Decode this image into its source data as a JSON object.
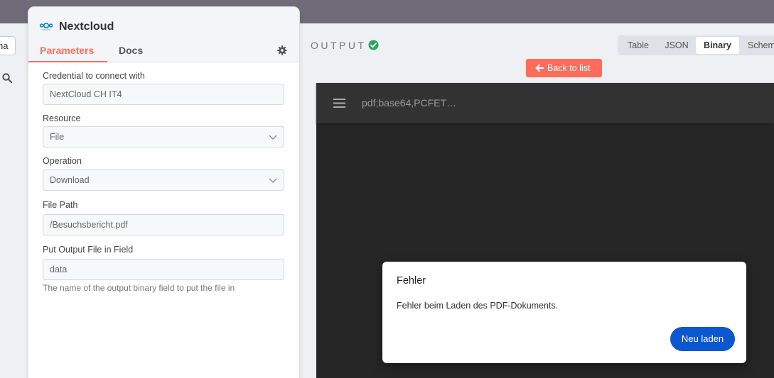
{
  "prev_panel": {
    "input_value": "na"
  },
  "node": {
    "title": "Nextcloud",
    "tabs": [
      {
        "label": "Parameters",
        "active": true
      },
      {
        "label": "Docs",
        "active": false
      }
    ],
    "fields": {
      "credential": {
        "label": "Credential to connect with",
        "value": "NextCloud CH IT4"
      },
      "resource": {
        "label": "Resource",
        "value": "File"
      },
      "operation": {
        "label": "Operation",
        "value": "Download"
      },
      "file_path": {
        "label": "File Path",
        "value": "/Besuchsbericht.pdf"
      },
      "output_field": {
        "label": "Put Output File in Field",
        "value": "data",
        "hint": "The name of the output binary field to put the file in"
      }
    }
  },
  "output": {
    "title": "OUTPUT",
    "status_icon": "success-check-icon",
    "view_modes": [
      "Table",
      "JSON",
      "Binary",
      "Schema"
    ],
    "active_view": "Binary",
    "back_button": "Back to list"
  },
  "viewer": {
    "title": "pdf;base64,PCFET…",
    "dialog": {
      "title": "Fehler",
      "message": "Fehler beim Laden des PDF-Dokuments.",
      "button": "Neu laden"
    }
  },
  "colors": {
    "accent": "#ff6d5a",
    "success": "#29a568",
    "viewer_bg": "#262626",
    "dialog_button": "#0b57d0"
  }
}
